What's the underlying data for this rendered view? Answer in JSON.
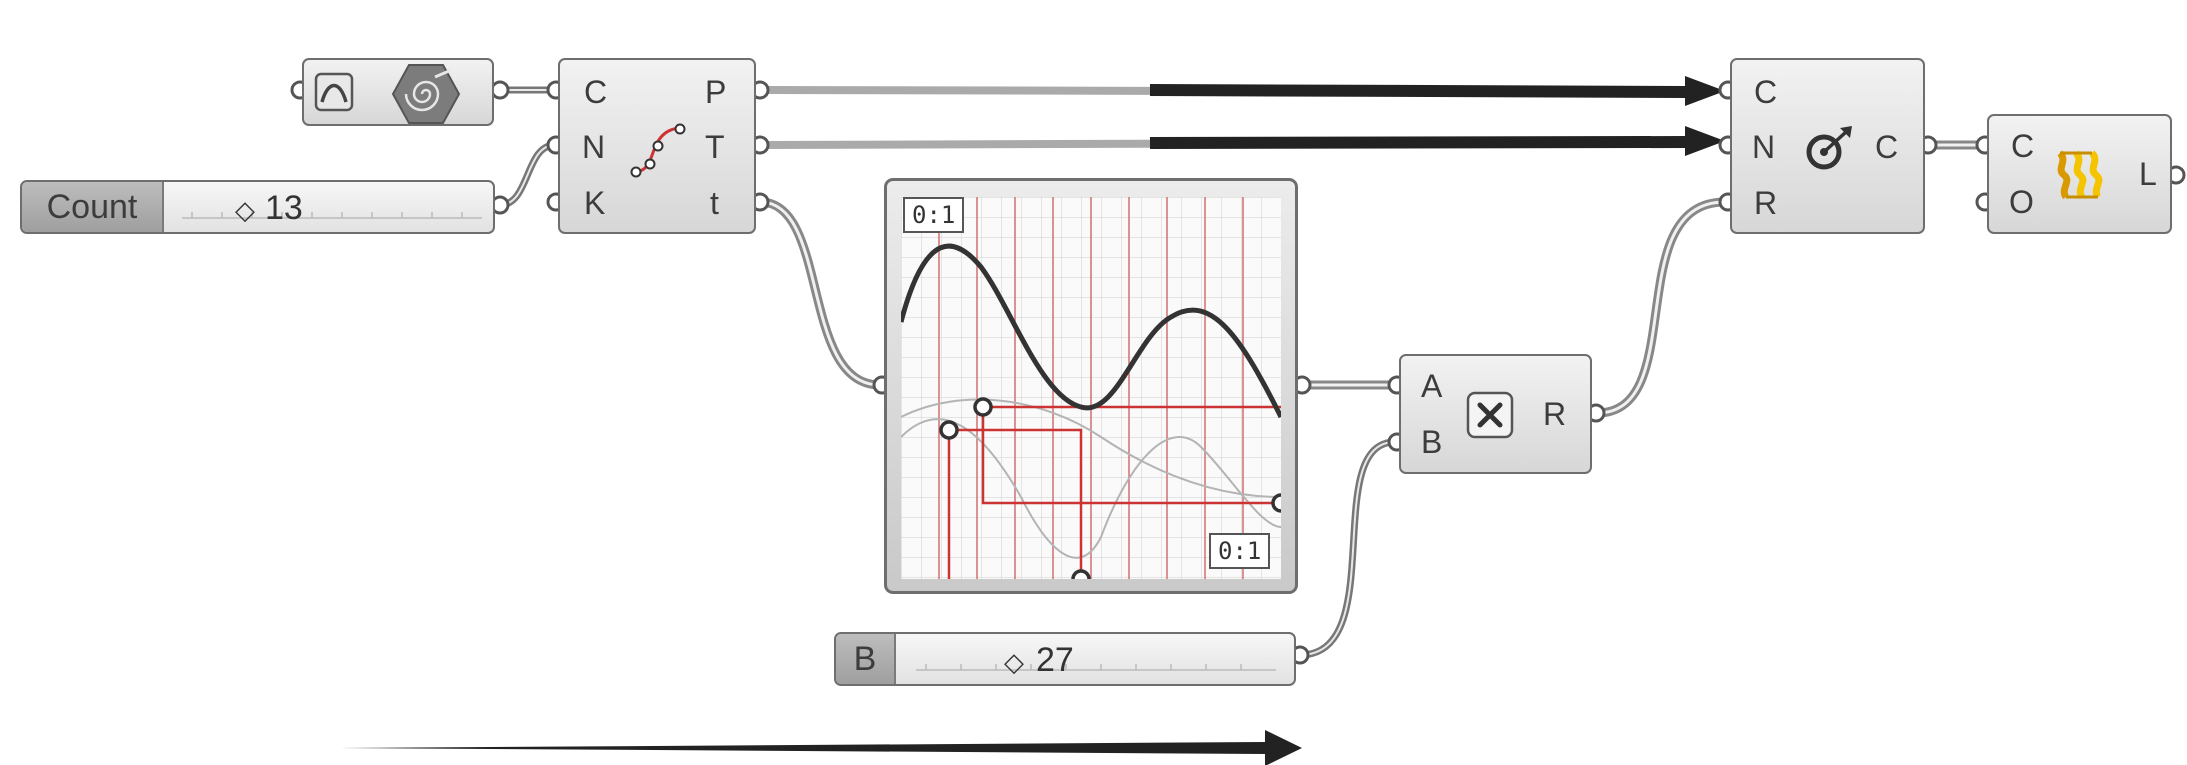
{
  "components": {
    "curve_param": {
      "icon": "spiral-curve-icon",
      "toggle_icon": "curve-toggle-icon"
    },
    "divide_curve": {
      "icon": "divide-curve-icon",
      "inputs": [
        "C",
        "N",
        "K"
      ],
      "outputs": [
        "P",
        "T",
        "t"
      ]
    },
    "count_slider": {
      "name": "Count",
      "value": "13"
    },
    "graph_mapper": {
      "domain_x_label": "0:1",
      "domain_y_label": "0:1",
      "curve": {
        "type": "sine-wave",
        "ylim": [
          0,
          1
        ],
        "xlim": [
          0,
          1
        ]
      }
    },
    "multiplication": {
      "icon": "multiply-icon",
      "inputs": [
        "A",
        "B"
      ],
      "outputs": [
        "R"
      ]
    },
    "b_slider": {
      "name": "B",
      "value": "27"
    },
    "circle_cnr": {
      "icon": "circle-target-icon",
      "inputs": [
        "C",
        "N",
        "R"
      ],
      "outputs": [
        "C"
      ]
    },
    "loft": {
      "icon": "loft-icon",
      "inputs": [
        "C",
        "O"
      ],
      "outputs": [
        "L"
      ]
    }
  },
  "colors": {
    "component_border": "#6e6e6e",
    "wire": "#8a8a8a",
    "graph_grid_red": "#cc4444",
    "curve_dark": "#333333",
    "loft_icon_yellow": "#f5c400"
  }
}
